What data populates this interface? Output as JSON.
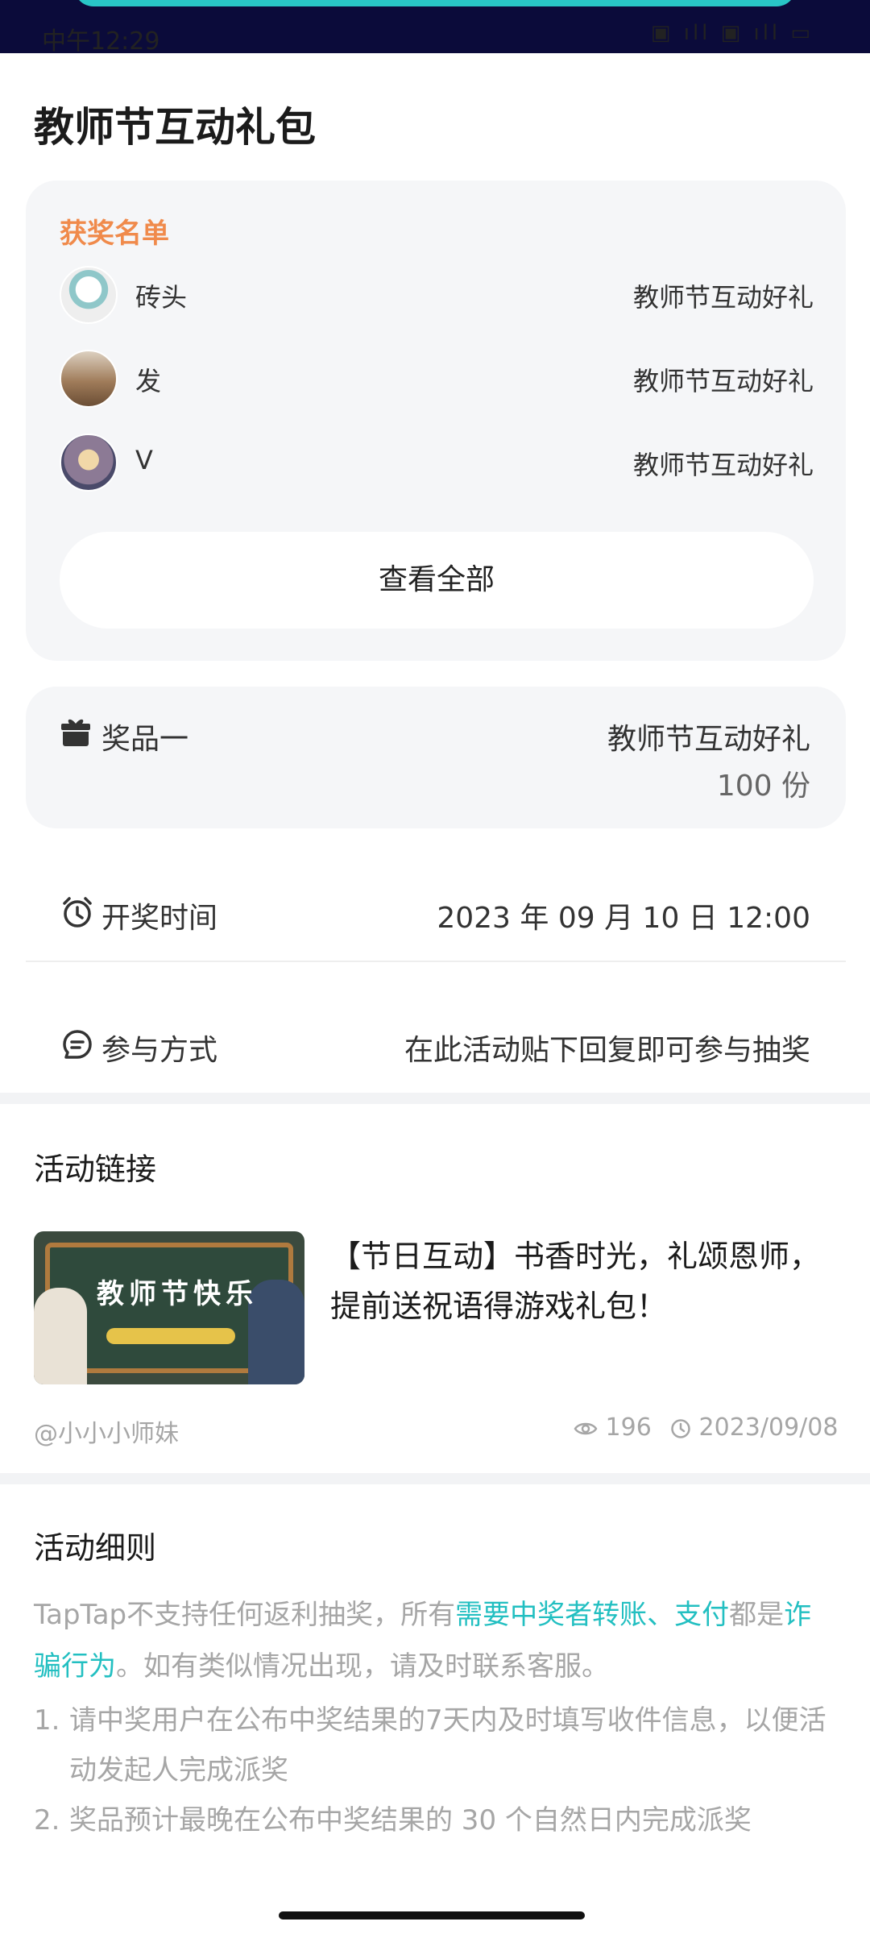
{
  "status_bar": {
    "time": "中午12:29",
    "icons": "▣ ıll ▣ ıll ▭"
  },
  "page": {
    "title": "教师节互动礼包"
  },
  "winners": {
    "heading": "获奖名单",
    "items": [
      {
        "name": "砖头",
        "prize": "教师节互动好礼"
      },
      {
        "name": "发",
        "prize": "教师节互动好礼"
      },
      {
        "name": "V",
        "prize": "教师节互动好礼"
      }
    ],
    "view_all_label": "查看全部"
  },
  "prize": {
    "label": "奖品一",
    "name": "教师节互动好礼",
    "quantity": "100 份",
    "icon": "gift-icon"
  },
  "draw_time": {
    "label": "开奖时间",
    "value": "2023 年 09 月 10 日 12:00",
    "icon": "alarm-clock-icon"
  },
  "participation": {
    "label": "参与方式",
    "value": "在此活动贴下回复即可参与抽奖",
    "icon": "chat-icon"
  },
  "activity_link": {
    "section_title": "活动链接",
    "thumbnail_text": "教师节快乐",
    "post_title": "【节日互动】书香时光，礼颂恩师，提前送祝语得游戏礼包！",
    "author": "@小小小师妹",
    "views": "196",
    "date": "2023/09/08"
  },
  "rules": {
    "section_title": "活动细则",
    "para_part1": "TapTap不支持任何返利抽奖，所有",
    "para_highlight1": "需要中奖者转账、支付",
    "para_part2": "都是",
    "para_highlight2": "诈骗行为",
    "para_part3": "。如有类似情况出现，请及时联系客服。",
    "items": [
      {
        "num": "1.",
        "text": "请中奖用户在公布中奖结果的7天内及时填写收件信息，以便活动发起人完成派奖"
      },
      {
        "num": "2.",
        "text": "奖品预计最晚在公布中奖结果的 30 个自然日内完成派奖"
      }
    ]
  },
  "colors": {
    "accent_teal": "#22bfc1",
    "heading_orange": "#f08a4b",
    "card_bg": "#f5f6f8"
  }
}
